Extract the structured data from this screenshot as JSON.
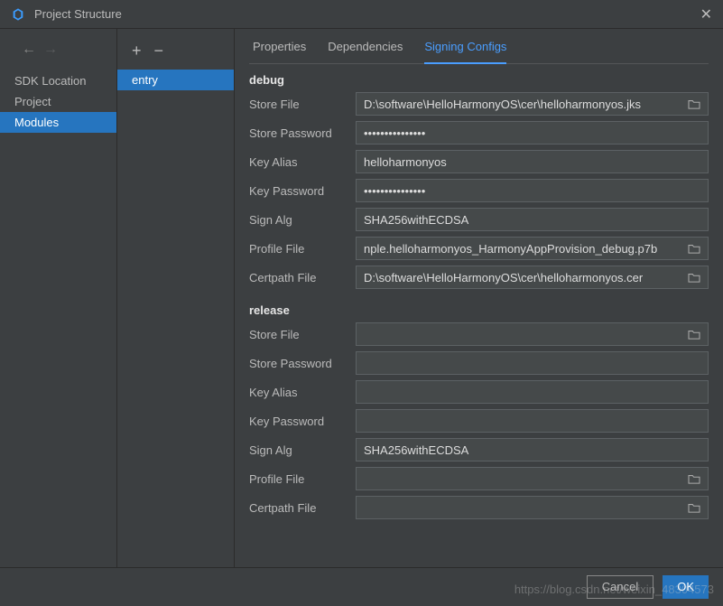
{
  "window": {
    "title": "Project Structure"
  },
  "nav": {
    "items": [
      {
        "label": "SDK Location",
        "selected": false
      },
      {
        "label": "Project",
        "selected": false
      },
      {
        "label": "Modules",
        "selected": true
      }
    ]
  },
  "modules": {
    "items": [
      {
        "label": "entry",
        "selected": true
      }
    ]
  },
  "tabs": [
    {
      "label": "Properties",
      "active": false
    },
    {
      "label": "Dependencies",
      "active": false
    },
    {
      "label": "Signing Configs",
      "active": true
    }
  ],
  "sections": {
    "debug": {
      "heading": "debug",
      "fields": {
        "store_file": {
          "label": "Store File",
          "value": "D:\\software\\HelloHarmonyOS\\cer\\helloharmonyos.jks",
          "browse": true
        },
        "store_password": {
          "label": "Store Password",
          "value": "•••••••••••••••",
          "browse": false
        },
        "key_alias": {
          "label": "Key Alias",
          "value": "helloharmonyos",
          "browse": false
        },
        "key_password": {
          "label": "Key Password",
          "value": "•••••••••••••••",
          "browse": false
        },
        "sign_alg": {
          "label": "Sign Alg",
          "value": "SHA256withECDSA",
          "browse": false
        },
        "profile_file": {
          "label": "Profile File",
          "value": "nple.helloharmonyos_HarmonyAppProvision_debug.p7b",
          "browse": true
        },
        "certpath_file": {
          "label": "Certpath File",
          "value": "D:\\software\\HelloHarmonyOS\\cer\\helloharmonyos.cer",
          "browse": true
        }
      }
    },
    "release": {
      "heading": "release",
      "fields": {
        "store_file": {
          "label": "Store File",
          "value": "",
          "browse": true
        },
        "store_password": {
          "label": "Store Password",
          "value": "",
          "browse": false
        },
        "key_alias": {
          "label": "Key Alias",
          "value": "",
          "browse": false
        },
        "key_password": {
          "label": "Key Password",
          "value": "",
          "browse": false
        },
        "sign_alg": {
          "label": "Sign Alg",
          "value": "SHA256withECDSA",
          "browse": false
        },
        "profile_file": {
          "label": "Profile File",
          "value": "",
          "browse": true
        },
        "certpath_file": {
          "label": "Certpath File",
          "value": "",
          "browse": true
        }
      }
    }
  },
  "footer": {
    "cancel": "Cancel",
    "ok": "OK"
  },
  "watermark": "https://blog.csdn.net/weixin_48304573"
}
